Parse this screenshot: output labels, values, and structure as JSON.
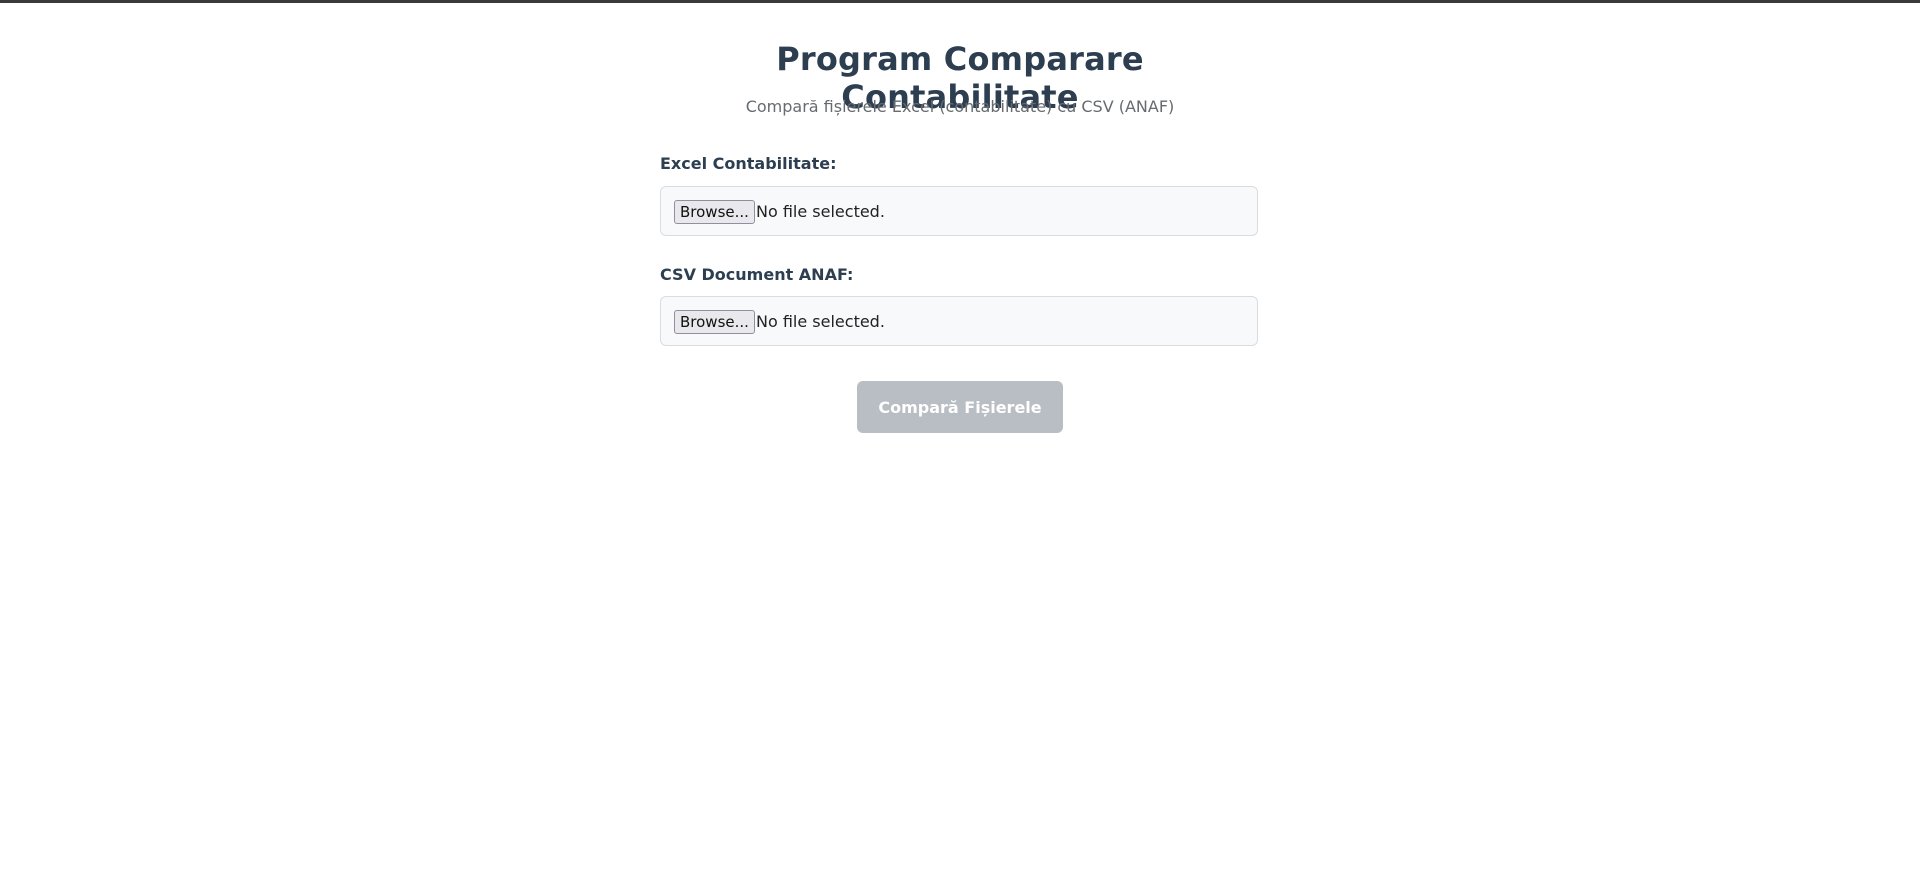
{
  "header": {
    "title": "Program Comparare Contabilitate",
    "subtitle": "Compară fișierele Excel (contabilitate) cu CSV (ANAF)"
  },
  "form": {
    "excel": {
      "label": "Excel Contabilitate:",
      "browse_label": "Browse...",
      "status": "No file selected."
    },
    "csv": {
      "label": "CSV Document ANAF:",
      "browse_label": "Browse...",
      "status": "No file selected."
    },
    "compare_label": "Compară Fișierele"
  },
  "colors": {
    "title": "#2c3e50",
    "button_disabled": "#b8bec4",
    "box_background": "#f8f9fa"
  }
}
